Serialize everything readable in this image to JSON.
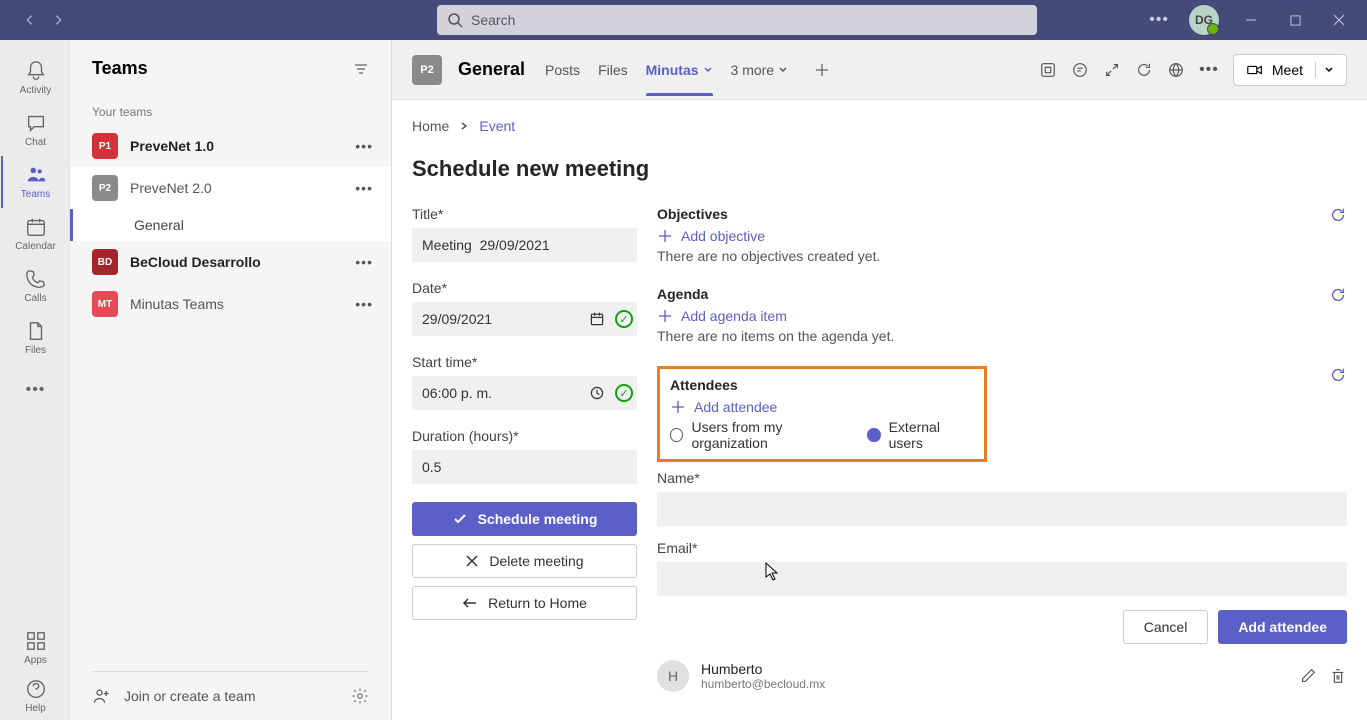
{
  "titlebar": {
    "search_placeholder": "Search",
    "user_initials": "DG"
  },
  "leftRail": {
    "activity": "Activity",
    "chat": "Chat",
    "teams": "Teams",
    "calendar": "Calendar",
    "calls": "Calls",
    "files": "Files",
    "apps": "Apps",
    "help": "Help"
  },
  "teamsPanel": {
    "title": "Teams",
    "your_teams": "Your teams",
    "teams": [
      {
        "initials": "P1",
        "name": "PreveNet 1.0"
      },
      {
        "initials": "P2",
        "name": "PreveNet 2.0",
        "channels": [
          "General"
        ],
        "selected": true
      },
      {
        "initials": "BD",
        "name": "BeCloud Desarrollo"
      },
      {
        "initials": "MT",
        "name": "Minutas Teams"
      }
    ],
    "join_create": "Join or create a team"
  },
  "mainHeader": {
    "channel_initials": "P2",
    "channel_name": "General",
    "tabs": {
      "posts": "Posts",
      "files": "Files",
      "minutas": "Minutas",
      "more": "3 more"
    },
    "meet": "Meet"
  },
  "breadcrumb": {
    "home": "Home",
    "current": "Event"
  },
  "page": {
    "title": "Schedule new meeting"
  },
  "form": {
    "title_label": "Title*",
    "title_value": "Meeting  29/09/2021",
    "date_label": "Date*",
    "date_value": "29/09/2021",
    "starttime_label": "Start time*",
    "starttime_value": "06:00 p. m.",
    "duration_label": "Duration (hours)*",
    "duration_value": "0.5",
    "schedule_btn": "Schedule meeting",
    "delete_btn": "Delete meeting",
    "return_btn": "Return to Home"
  },
  "sections": {
    "objectives": {
      "title": "Objectives",
      "add": "Add objective",
      "empty": "There are no objectives created yet."
    },
    "agenda": {
      "title": "Agenda",
      "add": "Add agenda item",
      "empty": "There are no items on the agenda yet."
    },
    "attendees": {
      "title": "Attendees",
      "add": "Add attendee",
      "org_users": "Users from my organization",
      "ext_users": "External users",
      "name_label": "Name*",
      "email_label": "Email*",
      "cancel": "Cancel",
      "add_btn": "Add attendee",
      "list": [
        {
          "initial": "H",
          "name": "Humberto",
          "email": "humberto@becloud.mx"
        }
      ]
    }
  }
}
